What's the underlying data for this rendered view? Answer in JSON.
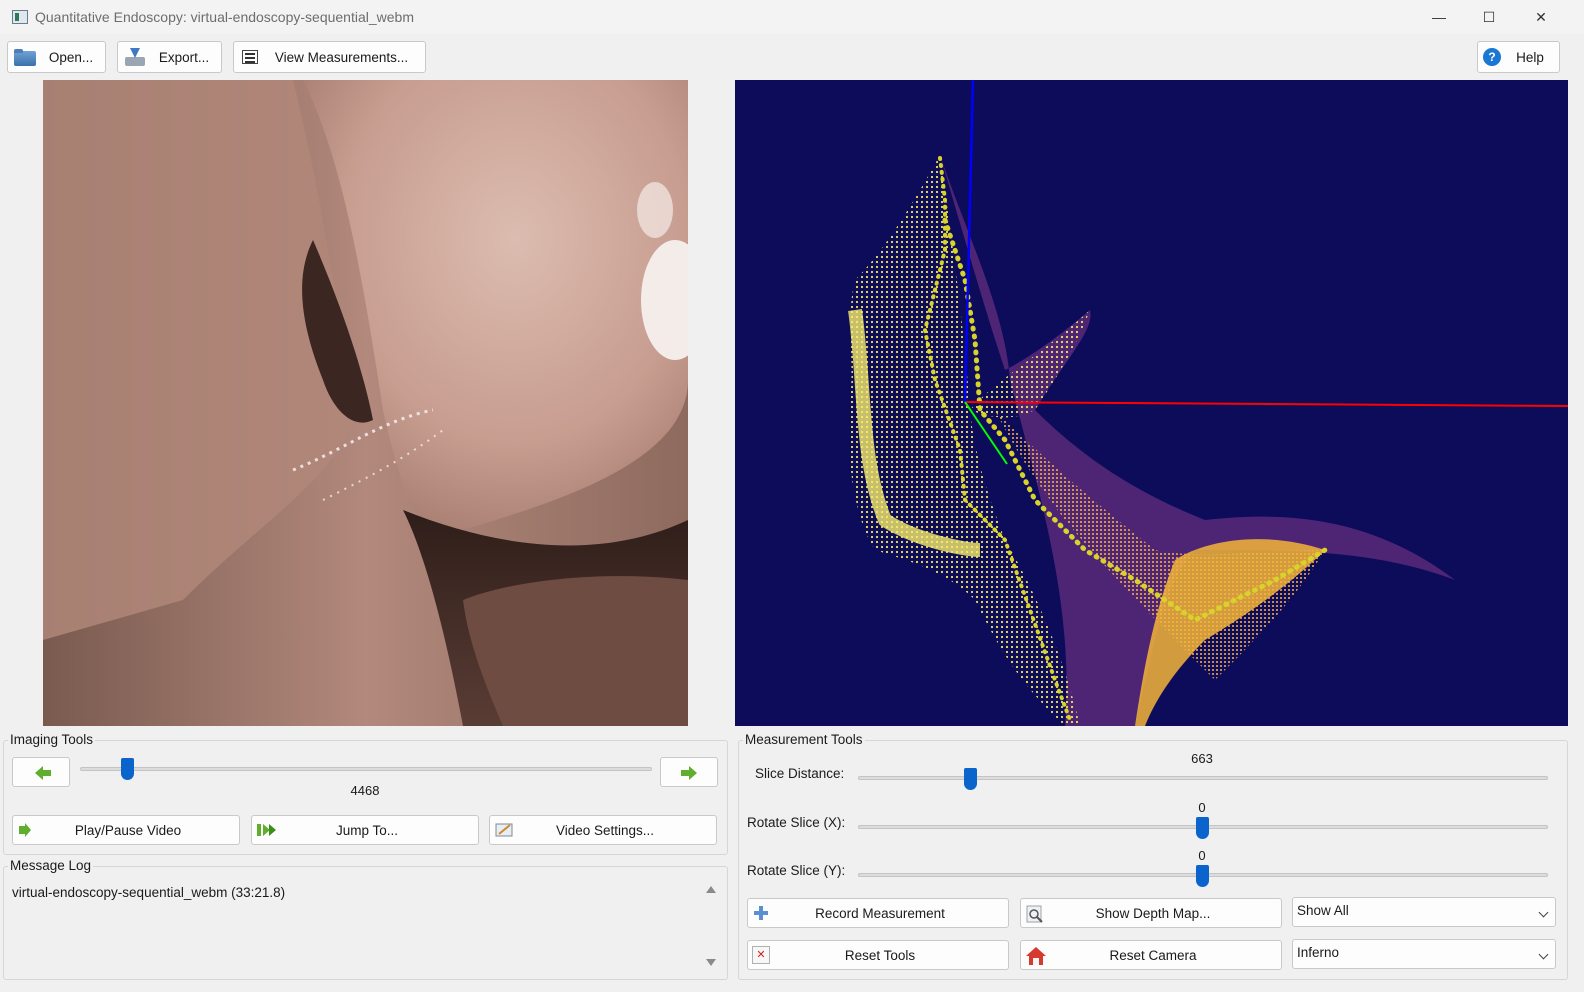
{
  "window": {
    "title": "Quantitative Endoscopy: virtual-endoscopy-sequential_webm",
    "minimize_glyph": "—",
    "maximize_glyph": "☐",
    "close_glyph": "✕"
  },
  "toolbar": {
    "open_label": "Open...",
    "export_label": "Export...",
    "view_measurements_label": "View Measurements...",
    "help_label": "Help",
    "help_glyph": "?"
  },
  "imaging_tools": {
    "title": "Imaging Tools",
    "frame_value": "4468",
    "play_pause_label": "Play/Pause Video",
    "jump_to_label": "Jump To...",
    "video_settings_label": "Video Settings..."
  },
  "message_log": {
    "title": "Message Log",
    "lines": [
      "virtual-endoscopy-sequential_webm (33:21.8)"
    ]
  },
  "measurement_tools": {
    "title": "Measurement Tools",
    "slice_distance_label": "Slice Distance:",
    "slice_distance_value": "663",
    "rotate_x_label": "Rotate Slice (X):",
    "rotate_x_value": "0",
    "rotate_y_label": "Rotate Slice (Y):",
    "rotate_y_value": "0",
    "record_measurement_label": "Record Measurement",
    "show_depth_map_label": "Show Depth Map...",
    "reset_tools_label": "Reset Tools",
    "reset_camera_label": "Reset Camera",
    "display_filter_value": "Show All",
    "colormap_value": "Inferno",
    "reset_tools_glyph": "✕"
  },
  "colors": {
    "accent": "#0a64cc",
    "viewer_background": "#0c0c5a",
    "axis_x": "#ff0000",
    "axis_y": "#00ff00",
    "axis_z": "#0000ff",
    "point_cloud": "#f0e24a"
  }
}
